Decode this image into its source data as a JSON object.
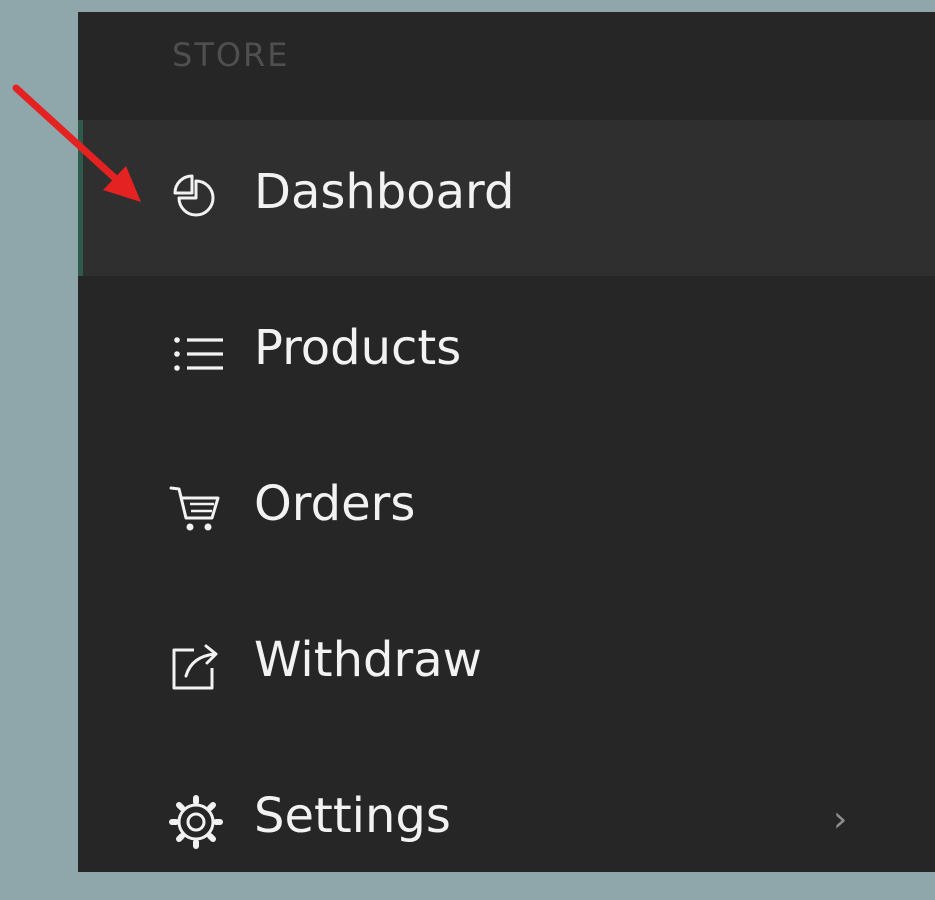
{
  "sidebar": {
    "section_title": "STORE",
    "items": [
      {
        "label": "Dashboard",
        "icon": "pie-chart-icon",
        "active": true
      },
      {
        "label": "Products",
        "icon": "list-icon",
        "active": false
      },
      {
        "label": "Orders",
        "icon": "cart-icon",
        "active": false
      },
      {
        "label": "Withdraw",
        "icon": "external-link-icon",
        "active": false
      },
      {
        "label": "Settings",
        "icon": "gear-icon",
        "active": false,
        "submenu_icon": "chevron-right-icon"
      }
    ]
  },
  "colors": {
    "background": "#8fa6ab",
    "sidebar": "#262626",
    "active_item": "#2f2f2f",
    "active_indicator": "#2f5a49",
    "text": "#f2f2f2",
    "section_title": "#4f4f4f",
    "annotation_arrow": "#e52222"
  }
}
